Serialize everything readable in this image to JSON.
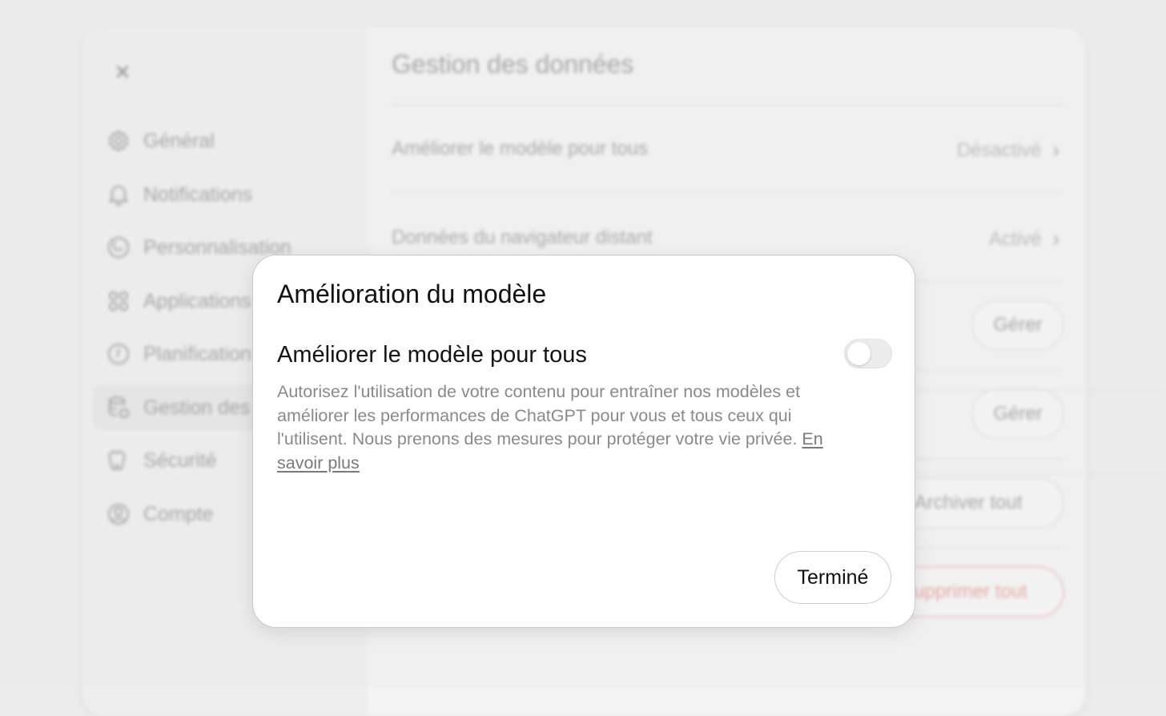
{
  "sidebar": {
    "close_label": "×",
    "items": [
      {
        "label": "Général",
        "icon": "gear-icon"
      },
      {
        "label": "Notifications",
        "icon": "bell-icon"
      },
      {
        "label": "Personnalisation",
        "icon": "personalization-icon"
      },
      {
        "label": "Applications",
        "icon": "grid-icon"
      },
      {
        "label": "Planification",
        "icon": "clock-icon"
      },
      {
        "label": "Gestion des données",
        "icon": "database-icon"
      },
      {
        "label": "Sécurité",
        "icon": "shield-icon"
      },
      {
        "label": "Compte",
        "icon": "user-circle-icon"
      }
    ]
  },
  "main": {
    "title": "Gestion des données",
    "rows": [
      {
        "label": "Améliorer le modèle pour tous",
        "value": "Désactivé"
      },
      {
        "label": "Données du navigateur distant",
        "value": "Activé"
      }
    ],
    "buttons": {
      "manage_1": "Gérer",
      "manage_2": "Gérer",
      "archive_all": "Archiver tout",
      "delete_all": "Supprimer tout"
    }
  },
  "modal": {
    "title": "Amélioration du modèle",
    "setting_title": "Améliorer le modèle pour tous",
    "toggle_on": false,
    "description": "Autorisez l'utilisation de votre contenu pour entraîner nos modèles et améliorer les performances de ChatGPT pour vous et tous ceux qui l'utilisent. Nous prenons des mesures pour protéger votre vie privée.",
    "learn_more": "En savoir plus",
    "done_label": "Terminé"
  },
  "colors": {
    "danger": "#e58d8d",
    "toggle_off": "#ececec"
  }
}
